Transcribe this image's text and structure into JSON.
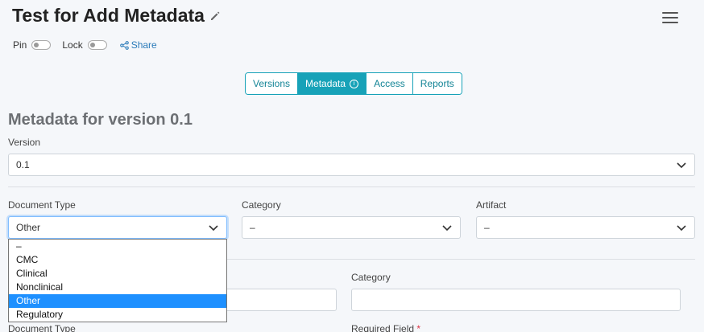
{
  "header": {
    "title": "Test for Add Metadata",
    "pin_label": "Pin",
    "lock_label": "Lock",
    "share_label": "Share"
  },
  "tabs": [
    {
      "label": "Versions",
      "active": false
    },
    {
      "label": "Metadata",
      "active": true
    },
    {
      "label": "Access",
      "active": false
    },
    {
      "label": "Reports",
      "active": false
    }
  ],
  "section": {
    "title": "Metadata for version 0.1",
    "version_label": "Version",
    "version_value": "0.1",
    "document_type_label": "Document Type",
    "document_type_value": "Other",
    "category_label": "Category",
    "category_value": "–",
    "artifact_label": "Artifact",
    "artifact_value": "–"
  },
  "lower": {
    "category_label": "Category",
    "document_type_label": "Document Type",
    "required_field_label": "Required Field",
    "required_marker": "*"
  },
  "dropdown": {
    "options": [
      "–",
      "CMC",
      "Clinical",
      "Nonclinical",
      "Other",
      "Regulatory"
    ],
    "selected": "Other"
  },
  "colors": {
    "accent": "#17a2b8",
    "selection": "#1e90ff",
    "required": "#dc3545"
  }
}
